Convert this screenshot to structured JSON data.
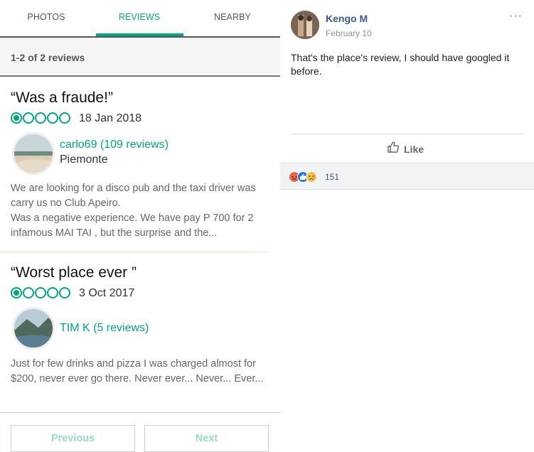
{
  "tabs": [
    {
      "label": "PHOTOS"
    },
    {
      "label": "REVIEWS"
    },
    {
      "label": "NEARBY"
    }
  ],
  "reviews_count": "1-2 of 2 reviews",
  "reviews": [
    {
      "title": "“Was a fraude!”",
      "rating": 1,
      "date": "18 Jan 2018",
      "user": "carlo69 (109 reviews)",
      "location": "Piemonte",
      "body": "We are looking for a disco pub and the taxi driver was carry us no Club Apeiro.\nWas a negative experience. We have pay P 700 for 2 infamous MAI TAI , but the surprise and the..."
    },
    {
      "title": "“Worst place ever ”",
      "rating": 1,
      "date": "3 Oct 2017",
      "user": "TIM K (5 reviews)",
      "location": "",
      "body": "Just for few drinks and pizza I was charged almost for $200, never ever go there. Never ever... Never... Ever..."
    }
  ],
  "pager": {
    "previous": "Previous",
    "next": "Next"
  },
  "post": {
    "author": "Kengo M",
    "date": "February 10",
    "more": "···",
    "text": "That's the place's review, I should have googled it before.",
    "like_label": "Like",
    "reaction_count": "151"
  },
  "colors": {
    "accent": "#00a680",
    "fb_blue": "#385898",
    "angry": "#f0653f",
    "like": "#1877f2",
    "sad": "#f7c244"
  }
}
